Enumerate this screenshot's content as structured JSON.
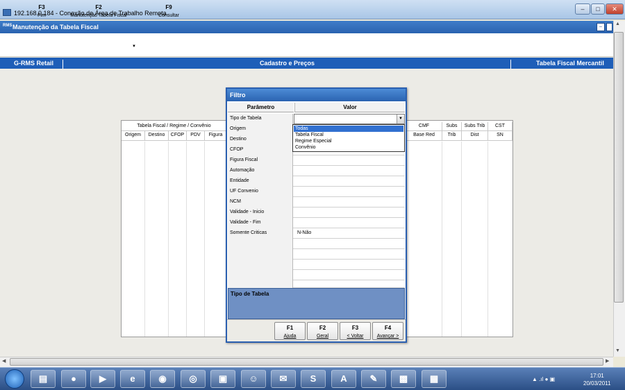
{
  "rdp": {
    "title": "192.168.0.184 - Conexão de Área de Trabalho Remota"
  },
  "app": {
    "title": "Manutenção da Tabela Fiscal",
    "icon_text": "RMS"
  },
  "toolbar": [
    {
      "key": "F3",
      "label": "Fim"
    },
    {
      "key": "F2",
      "label": "Manutenção Tabela Fiscal"
    },
    {
      "key": "F9",
      "label": "Consultar"
    }
  ],
  "caption": {
    "left": "G-RMS Retail",
    "center": "Cadastro e Preços",
    "right": "Tabela Fiscal Mercantil"
  },
  "grid": {
    "group_header": "Tabela Fiscal / Regime / Convênio",
    "columns_left": [
      "Origem",
      "Destino",
      "CFOP",
      "PDV",
      "Figura"
    ],
    "right_headers_top": [
      "CMF",
      "Subs",
      "Subs Trib",
      "CST"
    ],
    "right_headers_bottom": [
      "Base Red",
      "Trib",
      "Dist",
      "SN"
    ]
  },
  "dialog": {
    "title": "Filtro",
    "col_param": "Parâmetro",
    "col_value": "Valor",
    "params": [
      {
        "name": "Tipo de Tabela",
        "value": ""
      },
      {
        "name": "Origem",
        "value": ""
      },
      {
        "name": "Destino",
        "value": ""
      },
      {
        "name": "CFOP",
        "value": ""
      },
      {
        "name": "Figura Fiscal",
        "value": ""
      },
      {
        "name": "Automação",
        "value": ""
      },
      {
        "name": "Entidade",
        "value": ""
      },
      {
        "name": "UF Convenio",
        "value": ""
      },
      {
        "name": "NCM",
        "value": ""
      },
      {
        "name": "Validade - Inicio",
        "value": ""
      },
      {
        "name": "Validade - Fim",
        "value": ""
      },
      {
        "name": "Somente Criticas",
        "value": "N-Não"
      }
    ],
    "dropdown_options": [
      "Todas",
      "Tabela Fiscal",
      "Regime Especial",
      "Convênio"
    ],
    "dropdown_selected": "Todas",
    "help_text": "Tipo de Tabela",
    "buttons": [
      {
        "key": "F1",
        "label": "Ajuda"
      },
      {
        "key": "F2",
        "label": "Geral"
      },
      {
        "key": "F3",
        "label": "< Voltar"
      },
      {
        "key": "F4",
        "label": "Avançar >"
      }
    ]
  },
  "taskbar": {
    "time": "17:01",
    "date": "20/03/2011",
    "apps": [
      "folder-icon",
      "firefox-icon",
      "media-icon",
      "ie-icon",
      "hp-icon",
      "app-icon",
      "monitor-icon",
      "people-icon",
      "mail-icon",
      "skype-icon",
      "acrobat-icon",
      "paint-icon",
      "rdp-icon",
      "document-icon"
    ]
  }
}
